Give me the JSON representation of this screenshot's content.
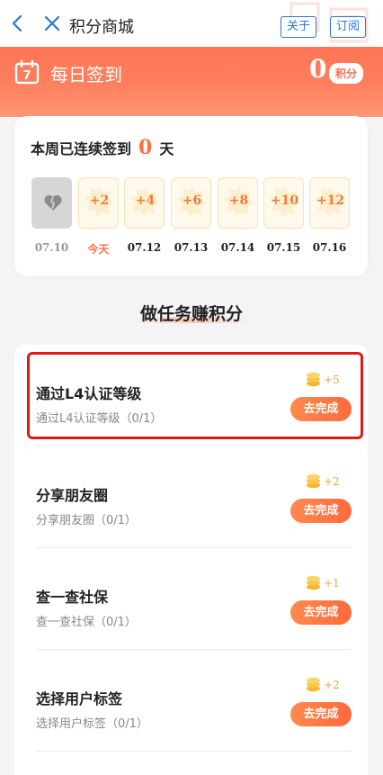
{
  "header": {
    "title": "积分商城",
    "about_label": "关于",
    "subscribe_label": "订阅"
  },
  "sign": {
    "title": "每日签到",
    "calendar_day": "7",
    "score": "0",
    "score_unit": "积分"
  },
  "streak": {
    "prefix": "本周已连续签到",
    "count": "0",
    "suffix": "天"
  },
  "days": [
    {
      "points": "",
      "date": "07.10",
      "state": "missed"
    },
    {
      "points": "+2",
      "date": "今天",
      "state": "today"
    },
    {
      "points": "+4",
      "date": "07.12",
      "state": "future"
    },
    {
      "points": "+6",
      "date": "07.13",
      "state": "future"
    },
    {
      "points": "+8",
      "date": "07.14",
      "state": "future"
    },
    {
      "points": "+10",
      "date": "07.15",
      "state": "future"
    },
    {
      "points": "+12",
      "date": "07.16",
      "state": "future"
    }
  ],
  "section": {
    "title": "做任务赚积分"
  },
  "tasks": [
    {
      "name": "通过L4认证等级",
      "sub": "通过L4认证等级（0/1）",
      "reward": "+5",
      "button": "去完成"
    },
    {
      "name": "分享朋友圈",
      "sub": "分享朋友圈（0/1）",
      "reward": "+2",
      "button": "去完成"
    },
    {
      "name": "查一查社保",
      "sub": "查一查社保（0/1）",
      "reward": "+1",
      "button": "去完成"
    },
    {
      "name": "选择用户标签",
      "sub": "选择用户标签（0/1）",
      "reward": "+2",
      "button": "去完成"
    }
  ],
  "colors": {
    "accent": "#ff6a4d",
    "link": "#2f73d8",
    "highlight": "#e01818",
    "reward": "#f0a040"
  }
}
